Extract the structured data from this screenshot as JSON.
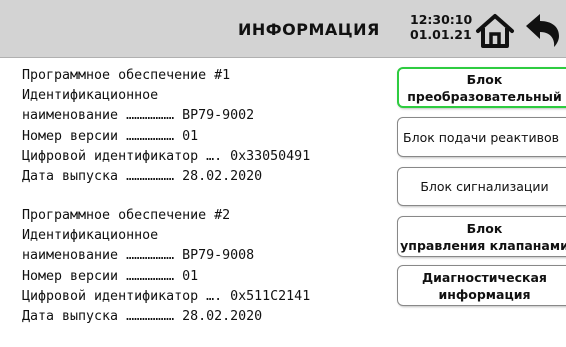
{
  "header": {
    "title": "ИНФОРМАЦИЯ",
    "time": "12:30:10",
    "date": "01.01.21",
    "home_icon": "home-icon",
    "back_icon": "back-arrow-icon"
  },
  "software": [
    {
      "title": "Программное обеспечение #1",
      "name_label_1": "Идентификационное",
      "name_label_2": "наименование ……………… ",
      "name_value": "ВР79-9002",
      "version_label": "Номер версии ……………… ",
      "version_value": "01",
      "digital_id_label": "Цифровой идентификатор …. ",
      "digital_id_value": "0x33050491",
      "release_label": "Дата выпуска ……………… ",
      "release_value": "28.02.2020"
    },
    {
      "title": "Программное обеспечение #2",
      "name_label_1": "Идентификационное",
      "name_label_2": "наименование ……………… ",
      "name_value": "ВР79-9008",
      "version_label": "Номер версии ……………… ",
      "version_value": "01",
      "digital_id_label": "Цифровой идентификатор …. ",
      "digital_id_value": "0x511C2141",
      "release_label": "Дата выпуска ……………… ",
      "release_value": "28.02.2020"
    }
  ],
  "menu": {
    "converter_block": "Блок преобразовательный",
    "reagent_block": "Блок подачи реактивов",
    "alarm_block": "Блок сигнализации",
    "valve_block": "Блок управления клапанами",
    "diagnostics": "Диагностическая информация"
  },
  "colors": {
    "header_bg": "#d3d3d3",
    "active_border": "#2ecc40"
  }
}
